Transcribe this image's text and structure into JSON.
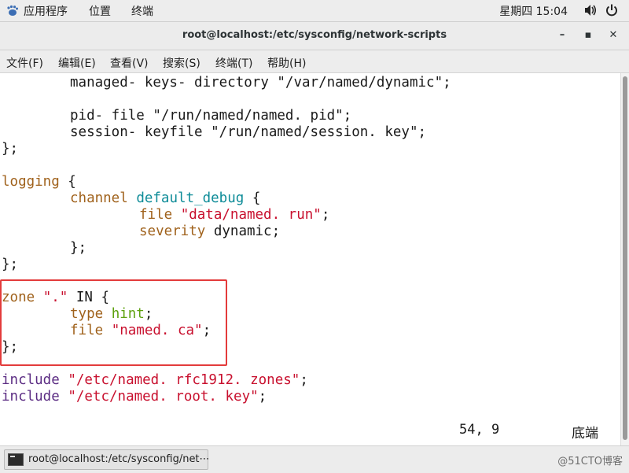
{
  "topbar": {
    "apps_label": "应用程序",
    "places_label": "位置",
    "terminal_label": "终端",
    "clock": "星期四 15:04"
  },
  "window": {
    "title": "root@localhost:/etc/sysconfig/network-scripts",
    "minimize": "–",
    "maximize": "▪",
    "close": "✕"
  },
  "menu": {
    "file": "文件(F)",
    "edit": "编辑(E)",
    "view": "查看(V)",
    "search": "搜索(S)",
    "terminal": "终端(T)",
    "help": "帮助(H)"
  },
  "editor": {
    "l1": "managed- keys- directory \"/var/named/dynamic\";",
    "l3": "pid- file \"/run/named/named. pid\";",
    "l4": "session- keyfile \"/run/named/session. key\";",
    "close_brace": "};",
    "logging_kw": "logging",
    "open_brace": " {",
    "channel_kw": "channel",
    "channel_name": "default_debug",
    "file_kw": "file",
    "file_val": "\"data/named. run\"",
    "semicolon": ";",
    "severity_kw": "severity",
    "severity_val": " dynamic;",
    "inner_close": "};",
    "zone_kw": "zone",
    "zone_name": " \".\"",
    "zone_in": " IN {",
    "type_kw": "type",
    "type_val": "hint",
    "zone_file_val": "\"named. ca\"",
    "include_kw": "include",
    "include1": "\"/etc/named. rfc1912. zones\"",
    "include2": "\"/etc/named. root. key\"",
    "cursor_pos": "54, 9",
    "position_label": "底端"
  },
  "taskbar": {
    "item_label": "root@localhost:/etc/sysconfig/net⋯",
    "watermark": "@51CTO博客"
  },
  "colors": {
    "keyword": "#a0621c",
    "type": "#5ea10f",
    "identifier": "#0e8c98",
    "string": "#c8102e",
    "include": "#5b2c83",
    "highlight_box": "#e33b3b"
  }
}
